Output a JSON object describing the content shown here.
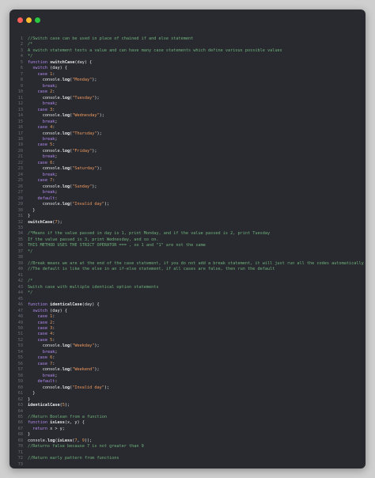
{
  "window": {
    "controls": {
      "close_color": "#fe5f57",
      "minimize_color": "#febc2e",
      "zoom_color": "#28c840"
    }
  },
  "colors": {
    "background": "#282a30",
    "keyword": "#b58cf2",
    "string": "#f09a5f",
    "comment": "#6fb07a",
    "text": "#e8e8e8",
    "line_number": "#6b6f78"
  },
  "code": {
    "lines": [
      [
        [
          "cm",
          "//Switch case can be used in place of chained if and else statement"
        ]
      ],
      [
        [
          "cm",
          "/*"
        ]
      ],
      [
        [
          "cm",
          "A switch statement tests a value and can have many case statements which define various possible values"
        ]
      ],
      [
        [
          "cm",
          "*/"
        ]
      ],
      [
        [
          "kw",
          "function "
        ],
        [
          "fn",
          "switchCase"
        ],
        [
          "tx",
          "(day) {"
        ]
      ],
      [
        [
          "tx",
          "  "
        ],
        [
          "kw",
          "switch"
        ],
        [
          "tx",
          " (day) {"
        ]
      ],
      [
        [
          "tx",
          "    "
        ],
        [
          "kw",
          "case"
        ],
        [
          "tx",
          " "
        ],
        [
          "num",
          "1"
        ],
        [
          "tx",
          ":"
        ]
      ],
      [
        [
          "tx",
          "      console."
        ],
        [
          "fn",
          "log"
        ],
        [
          "tx",
          "("
        ],
        [
          "str",
          "\"Monday\""
        ],
        [
          "tx",
          ");"
        ]
      ],
      [
        [
          "tx",
          "      "
        ],
        [
          "kw",
          "break"
        ],
        [
          "tx",
          ";"
        ]
      ],
      [
        [
          "tx",
          "    "
        ],
        [
          "kw",
          "case"
        ],
        [
          "tx",
          " "
        ],
        [
          "num",
          "2"
        ],
        [
          "tx",
          ":"
        ]
      ],
      [
        [
          "tx",
          "      console."
        ],
        [
          "fn",
          "log"
        ],
        [
          "tx",
          "("
        ],
        [
          "str",
          "\"Tuesday\""
        ],
        [
          "tx",
          ");"
        ]
      ],
      [
        [
          "tx",
          "      "
        ],
        [
          "kw",
          "break"
        ],
        [
          "tx",
          ";"
        ]
      ],
      [
        [
          "tx",
          "    "
        ],
        [
          "kw",
          "case"
        ],
        [
          "tx",
          " "
        ],
        [
          "num",
          "3"
        ],
        [
          "tx",
          ":"
        ]
      ],
      [
        [
          "tx",
          "      console."
        ],
        [
          "fn",
          "log"
        ],
        [
          "tx",
          "("
        ],
        [
          "str",
          "\"Wednesday\""
        ],
        [
          "tx",
          ");"
        ]
      ],
      [
        [
          "tx",
          "      "
        ],
        [
          "kw",
          "break"
        ],
        [
          "tx",
          ";"
        ]
      ],
      [
        [
          "tx",
          "    "
        ],
        [
          "kw",
          "case"
        ],
        [
          "tx",
          " "
        ],
        [
          "num",
          "4"
        ],
        [
          "tx",
          ":"
        ]
      ],
      [
        [
          "tx",
          "      console."
        ],
        [
          "fn",
          "log"
        ],
        [
          "tx",
          "("
        ],
        [
          "str",
          "\"Thursday\""
        ],
        [
          "tx",
          ");"
        ]
      ],
      [
        [
          "tx",
          "      "
        ],
        [
          "kw",
          "break"
        ],
        [
          "tx",
          ";"
        ]
      ],
      [
        [
          "tx",
          "    "
        ],
        [
          "kw",
          "case"
        ],
        [
          "tx",
          " "
        ],
        [
          "num",
          "5"
        ],
        [
          "tx",
          ":"
        ]
      ],
      [
        [
          "tx",
          "      console."
        ],
        [
          "fn",
          "log"
        ],
        [
          "tx",
          "("
        ],
        [
          "str",
          "\"Friday\""
        ],
        [
          "tx",
          ");"
        ]
      ],
      [
        [
          "tx",
          "      "
        ],
        [
          "kw",
          "break"
        ],
        [
          "tx",
          ";"
        ]
      ],
      [
        [
          "tx",
          "    "
        ],
        [
          "kw",
          "case"
        ],
        [
          "tx",
          " "
        ],
        [
          "num",
          "6"
        ],
        [
          "tx",
          ":"
        ]
      ],
      [
        [
          "tx",
          "      console."
        ],
        [
          "fn",
          "log"
        ],
        [
          "tx",
          "("
        ],
        [
          "str",
          "\"Saturday\""
        ],
        [
          "tx",
          ");"
        ]
      ],
      [
        [
          "tx",
          "      "
        ],
        [
          "kw",
          "break"
        ],
        [
          "tx",
          ";"
        ]
      ],
      [
        [
          "tx",
          "    "
        ],
        [
          "kw",
          "case"
        ],
        [
          "tx",
          " "
        ],
        [
          "num",
          "7"
        ],
        [
          "tx",
          ":"
        ]
      ],
      [
        [
          "tx",
          "      console."
        ],
        [
          "fn",
          "log"
        ],
        [
          "tx",
          "("
        ],
        [
          "str",
          "\"Sunday\""
        ],
        [
          "tx",
          ");"
        ]
      ],
      [
        [
          "tx",
          "      "
        ],
        [
          "kw",
          "break"
        ],
        [
          "tx",
          ";"
        ]
      ],
      [
        [
          "tx",
          "    "
        ],
        [
          "kw",
          "default"
        ],
        [
          "tx",
          ":"
        ]
      ],
      [
        [
          "tx",
          "      console."
        ],
        [
          "fn",
          "log"
        ],
        [
          "tx",
          "("
        ],
        [
          "str",
          "\"Invalid day\""
        ],
        [
          "tx",
          ");"
        ]
      ],
      [
        [
          "tx",
          "  }"
        ]
      ],
      [
        [
          "tx",
          "}"
        ]
      ],
      [
        [
          "fn",
          "switchCase"
        ],
        [
          "tx",
          "("
        ],
        [
          "num",
          "7"
        ],
        [
          "tx",
          ");"
        ]
      ],
      [],
      [
        [
          "cm",
          "/*Means if the value passed in day is 1, print Monday, and if the value passed is 2, print Tuesday"
        ]
      ],
      [
        [
          "cm",
          "If the value passed is 3, print Wednesday, and so on."
        ]
      ],
      [
        [
          "cm",
          "THIS METHOD USES THE STRICT OPERATOR === , so 1 and \"1\" are not the same"
        ]
      ],
      [
        [
          "cm",
          "*/"
        ]
      ],
      [],
      [
        [
          "cm",
          "//Break means we are at the end of the case statement, if you do not add a break statement, it will just run all the codes automatically"
        ]
      ],
      [
        [
          "cm",
          "//The default is like the else in an if-else statement, if all cases are false, then run the default"
        ]
      ],
      [],
      [
        [
          "cm",
          "/*"
        ]
      ],
      [
        [
          "cm",
          "Switch case with multiple identical option statements"
        ]
      ],
      [
        [
          "cm",
          "*/"
        ]
      ],
      [],
      [
        [
          "kw",
          "function "
        ],
        [
          "fn",
          "identicalCase"
        ],
        [
          "tx",
          "(day) {"
        ]
      ],
      [
        [
          "tx",
          "  "
        ],
        [
          "kw",
          "switch"
        ],
        [
          "tx",
          " (day) {"
        ]
      ],
      [
        [
          "tx",
          "    "
        ],
        [
          "kw",
          "case"
        ],
        [
          "tx",
          " "
        ],
        [
          "num",
          "1"
        ],
        [
          "tx",
          ":"
        ]
      ],
      [
        [
          "tx",
          "    "
        ],
        [
          "kw",
          "case"
        ],
        [
          "tx",
          " "
        ],
        [
          "num",
          "2"
        ],
        [
          "tx",
          ":"
        ]
      ],
      [
        [
          "tx",
          "    "
        ],
        [
          "kw",
          "case"
        ],
        [
          "tx",
          " "
        ],
        [
          "num",
          "3"
        ],
        [
          "tx",
          ":"
        ]
      ],
      [
        [
          "tx",
          "    "
        ],
        [
          "kw",
          "case"
        ],
        [
          "tx",
          " "
        ],
        [
          "num",
          "4"
        ],
        [
          "tx",
          ":"
        ]
      ],
      [
        [
          "tx",
          "    "
        ],
        [
          "kw",
          "case"
        ],
        [
          "tx",
          " "
        ],
        [
          "num",
          "5"
        ],
        [
          "tx",
          ":"
        ]
      ],
      [
        [
          "tx",
          "      console."
        ],
        [
          "fn",
          "log"
        ],
        [
          "tx",
          "("
        ],
        [
          "str",
          "\"Weekday\""
        ],
        [
          "tx",
          ");"
        ]
      ],
      [
        [
          "tx",
          "      "
        ],
        [
          "kw",
          "break"
        ],
        [
          "tx",
          ";"
        ]
      ],
      [
        [
          "tx",
          "    "
        ],
        [
          "kw",
          "case"
        ],
        [
          "tx",
          " "
        ],
        [
          "num",
          "6"
        ],
        [
          "tx",
          ":"
        ]
      ],
      [
        [
          "tx",
          "    "
        ],
        [
          "kw",
          "case"
        ],
        [
          "tx",
          " "
        ],
        [
          "num",
          "7"
        ],
        [
          "tx",
          ":"
        ]
      ],
      [
        [
          "tx",
          "      console."
        ],
        [
          "fn",
          "log"
        ],
        [
          "tx",
          "("
        ],
        [
          "str",
          "\"Weekend\""
        ],
        [
          "tx",
          ");"
        ]
      ],
      [
        [
          "tx",
          "      "
        ],
        [
          "kw",
          "break"
        ],
        [
          "tx",
          ";"
        ]
      ],
      [
        [
          "tx",
          "    "
        ],
        [
          "kw",
          "default"
        ],
        [
          "tx",
          ":"
        ]
      ],
      [
        [
          "tx",
          "      console."
        ],
        [
          "fn",
          "log"
        ],
        [
          "tx",
          "("
        ],
        [
          "str",
          "\"Invalid day\""
        ],
        [
          "tx",
          ");"
        ]
      ],
      [
        [
          "tx",
          "  }"
        ]
      ],
      [
        [
          "tx",
          "}"
        ]
      ],
      [
        [
          "fn",
          "identicalCase"
        ],
        [
          "tx",
          "("
        ],
        [
          "num",
          "5"
        ],
        [
          "tx",
          ");"
        ]
      ],
      [],
      [
        [
          "cm",
          "//Return Boolean from a function"
        ]
      ],
      [
        [
          "kw",
          "function "
        ],
        [
          "fn",
          "isLess"
        ],
        [
          "tx",
          "(x, y) {"
        ]
      ],
      [
        [
          "tx",
          "  "
        ],
        [
          "kw",
          "return"
        ],
        [
          "tx",
          " x > y;"
        ]
      ],
      [
        [
          "tx",
          "}"
        ]
      ],
      [
        [
          "tx",
          "console."
        ],
        [
          "fn",
          "log"
        ],
        [
          "tx",
          "("
        ],
        [
          "fn",
          "isLess"
        ],
        [
          "tx",
          "("
        ],
        [
          "num",
          "7"
        ],
        [
          "tx",
          ", "
        ],
        [
          "num",
          "9"
        ],
        [
          "tx",
          "));"
        ]
      ],
      [
        [
          "cm",
          "//Returns false because 7 is not greater than 9"
        ]
      ],
      [],
      [
        [
          "cm",
          "//Return early pattern from functions"
        ]
      ],
      []
    ]
  }
}
